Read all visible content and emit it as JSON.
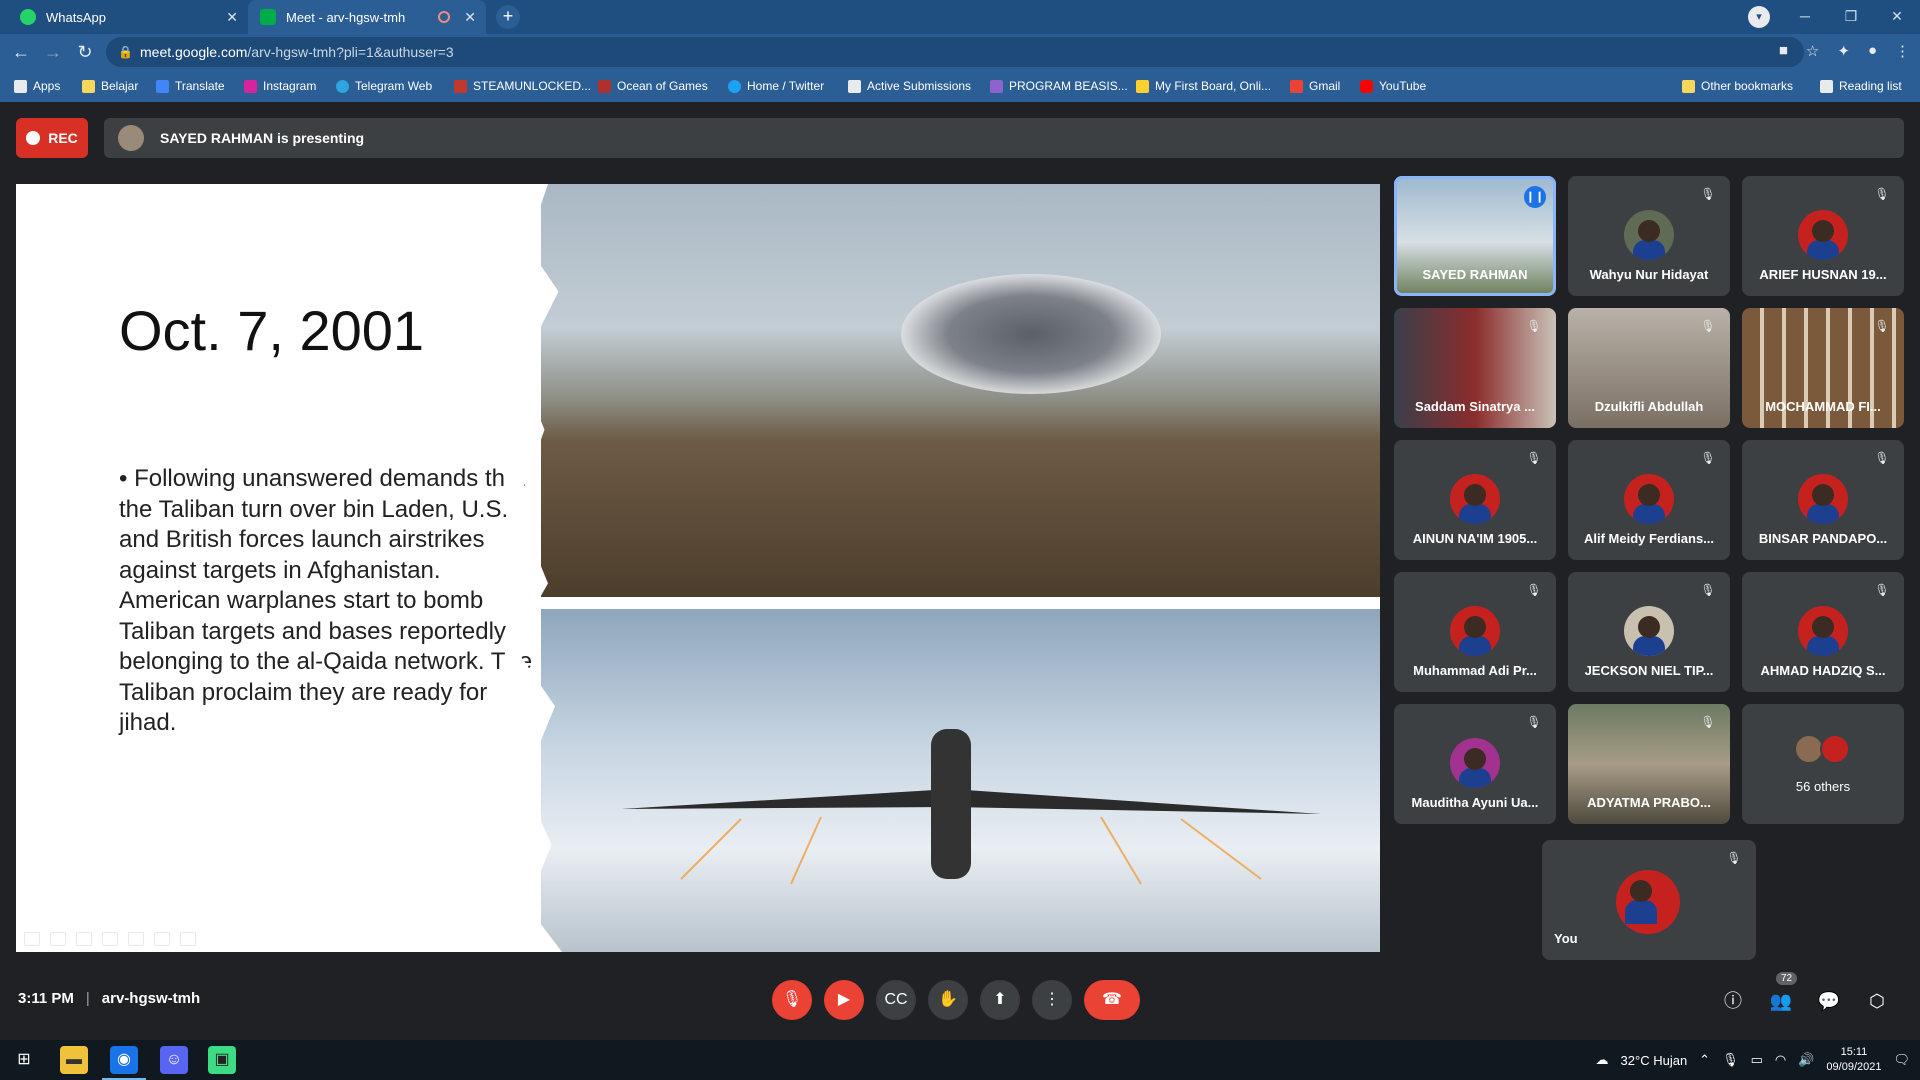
{
  "browser": {
    "tabs": [
      {
        "title": "WhatsApp",
        "color": "#25d366"
      },
      {
        "title": "Meet - arv-hgsw-tmh",
        "color": "#00ac47"
      }
    ],
    "url_host": "meet.google.com",
    "url_path": "/arv-hgsw-tmh?pli=1&authuser=3",
    "bookmarks": [
      "Apps",
      "Belajar",
      "Translate",
      "Instagram",
      "Telegram Web",
      "STEAMUNLOCKED...",
      "Ocean of Games",
      "Home / Twitter",
      "Active Submissions",
      "PROGRAM BEASIS...",
      "My First Board, Onli...",
      "Gmail",
      "YouTube",
      "Other bookmarks",
      "Reading list"
    ]
  },
  "meet": {
    "rec_label": "REC",
    "presenting_text": "SAYED RAHMAN is presenting",
    "slide": {
      "title": "Oct. 7, 2001",
      "bullet": "Following unanswered demands that the Taliban turn over bin Laden, U.S. and British forces launch airstrikes against targets in Afghanistan. American warplanes start to bomb Taliban targets and bases reportedly belonging to the al-Qaida network. The Taliban proclaim they are ready for jihad."
    },
    "participants": [
      "SAYED RAHMAN",
      "Wahyu Nur Hidayat",
      "ARIEF HUSNAN 19...",
      "Saddam Sinatrya ...",
      "Dzulkifli Abdullah",
      "MOCHAMMAD FI...",
      "AINUN NA'IM 1905...",
      "Alif Meidy Ferdians...",
      "BINSAR PANDAPO...",
      "Muhammad Adi Pr...",
      "JECKSON NIEL TIP...",
      "AHMAD HADZIQ S...",
      "Mauditha Ayuni Ua...",
      "ADYATMA PRABO...",
      "56 others"
    ],
    "you_label": "You",
    "time": "3:11 PM",
    "meeting_code": "arv-hgsw-tmh",
    "people_count": "72"
  },
  "taskbar": {
    "weather": "32°C  Hujan",
    "time": "15:11",
    "date": "09/09/2021"
  },
  "colors": {
    "meet_bg": "#202124",
    "tile_bg": "#3c4043",
    "danger": "#ea4335",
    "browser": "#2a5e95"
  }
}
